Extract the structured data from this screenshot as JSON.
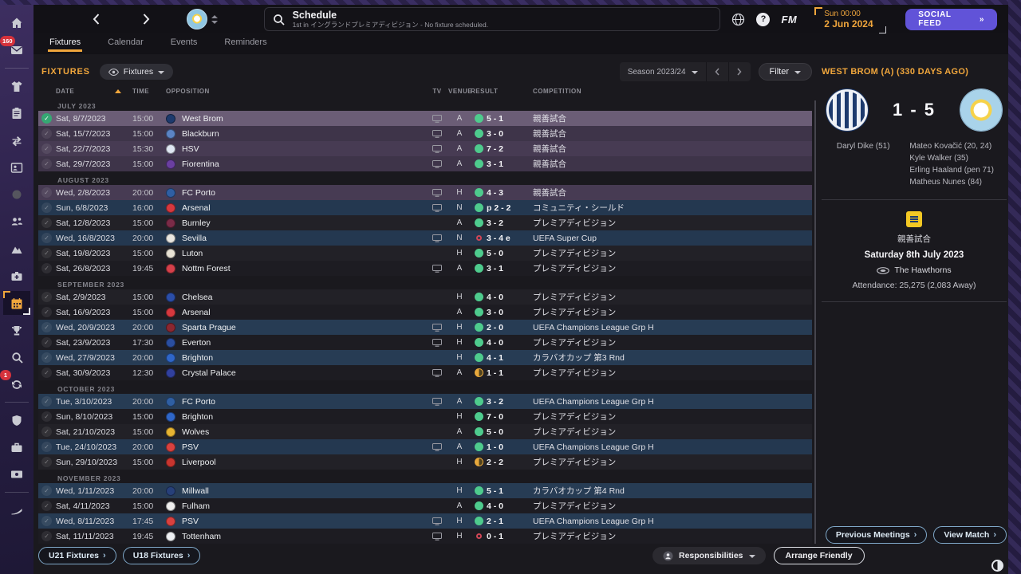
{
  "icons": {
    "help": "?",
    "check": "✓",
    "chevron_right": "›",
    "arrow_double": "»"
  },
  "titlebar": {
    "title": "Schedule",
    "subtitle": "1st in イングランドプレミアディビジョン - No fixture scheduled.",
    "fm_label": "FM",
    "clock_time": "Sun 00:00",
    "clock_date": "2 Jun 2024",
    "social_feed": "SOCIAL FEED"
  },
  "sidebar": {
    "inbox_badge": "160",
    "transfer_badge": "1"
  },
  "tabs": [
    {
      "label": "Fixtures",
      "active": true
    },
    {
      "label": "Calendar",
      "active": false
    },
    {
      "label": "Events",
      "active": false
    },
    {
      "label": "Reminders",
      "active": false
    }
  ],
  "toolbar": {
    "section_label": "FIXTURES",
    "view_label": "Fixtures",
    "season_label": "Season 2023/24",
    "filter_label": "Filter"
  },
  "table_headers": {
    "date": "DATE",
    "time": "TIME",
    "opposition": "OPPOSITION",
    "tv": "TV",
    "venue": "VENUE",
    "result": "RESULT",
    "competition": "COMPETITION"
  },
  "fixtures": {
    "sections": [
      {
        "label": "JULY 2023",
        "rows": [
          {
            "date": "Sat, 8/7/2023",
            "time": "15:00",
            "team": "West Brom",
            "badge": "#1d3a6d",
            "tv": true,
            "venue": "A",
            "outcome": "W",
            "result": "5 - 1",
            "comp": "親善試合",
            "kind": "friendly",
            "selected": true
          },
          {
            "date": "Sat, 15/7/2023",
            "time": "15:00",
            "team": "Blackburn",
            "badge": "#5b84c4",
            "tv": true,
            "venue": "A",
            "outcome": "W",
            "result": "3 - 0",
            "comp": "親善試合",
            "kind": "friendly"
          },
          {
            "date": "Sat, 22/7/2023",
            "time": "15:30",
            "team": "HSV",
            "badge": "#dfe7f2",
            "tv": true,
            "venue": "A",
            "outcome": "W",
            "result": "7 - 2",
            "comp": "親善試合",
            "kind": "friendly"
          },
          {
            "date": "Sat, 29/7/2023",
            "time": "15:00",
            "team": "Fiorentina",
            "badge": "#6a3fa0",
            "tv": true,
            "venue": "A",
            "outcome": "W",
            "result": "3 - 1",
            "comp": "親善試合",
            "kind": "friendly"
          }
        ]
      },
      {
        "label": "AUGUST 2023",
        "rows": [
          {
            "date": "Wed, 2/8/2023",
            "time": "20:00",
            "team": "FC Porto",
            "badge": "#2f5fa3",
            "tv": true,
            "venue": "H",
            "outcome": "W",
            "result": "4 - 3",
            "comp": "親善試合",
            "kind": "friendly"
          },
          {
            "date": "Sun, 6/8/2023",
            "time": "16:00",
            "team": "Arsenal",
            "badge": "#d6383e",
            "tv": true,
            "venue": "N",
            "outcome": "W",
            "result": "p 2 - 2",
            "comp": "コミュニティ・シールド",
            "kind": "cup"
          },
          {
            "date": "Sat, 12/8/2023",
            "time": "15:00",
            "team": "Burnley",
            "badge": "#7a2b47",
            "tv": false,
            "venue": "A",
            "outcome": "W",
            "result": "3 - 2",
            "comp": "プレミアディビジョン",
            "kind": "league"
          },
          {
            "date": "Wed, 16/8/2023",
            "time": "20:00",
            "team": "Sevilla",
            "badge": "#e9e6e0",
            "tv": true,
            "venue": "N",
            "outcome": "L",
            "result": "3 - 4 e",
            "comp": "UEFA Super Cup",
            "kind": "cup"
          },
          {
            "date": "Sat, 19/8/2023",
            "time": "15:00",
            "team": "Luton",
            "badge": "#e8e2d4",
            "tv": false,
            "venue": "H",
            "outcome": "W",
            "result": "5 - 0",
            "comp": "プレミアディビジョン",
            "kind": "league"
          },
          {
            "date": "Sat, 26/8/2023",
            "time": "19:45",
            "team": "Nottm Forest",
            "badge": "#d5404a",
            "tv": true,
            "venue": "A",
            "outcome": "W",
            "result": "3 - 1",
            "comp": "プレミアディビジョン",
            "kind": "league"
          }
        ]
      },
      {
        "label": "SEPTEMBER 2023",
        "rows": [
          {
            "date": "Sat, 2/9/2023",
            "time": "15:00",
            "team": "Chelsea",
            "badge": "#2b4ea8",
            "tv": false,
            "venue": "H",
            "outcome": "W",
            "result": "4 - 0",
            "comp": "プレミアディビジョン",
            "kind": "league"
          },
          {
            "date": "Sat, 16/9/2023",
            "time": "15:00",
            "team": "Arsenal",
            "badge": "#d6383e",
            "tv": false,
            "venue": "A",
            "outcome": "W",
            "result": "3 - 0",
            "comp": "プレミアディビジョン",
            "kind": "league"
          },
          {
            "date": "Wed, 20/9/2023",
            "time": "20:00",
            "team": "Sparta Prague",
            "badge": "#8c2730",
            "tv": true,
            "venue": "H",
            "outcome": "W",
            "result": "2 - 0",
            "comp": "UEFA Champions League Grp H",
            "kind": "cup"
          },
          {
            "date": "Sat, 23/9/2023",
            "time": "17:30",
            "team": "Everton",
            "badge": "#2a4ea0",
            "tv": true,
            "venue": "H",
            "outcome": "W",
            "result": "4 - 0",
            "comp": "プレミアディビジョン",
            "kind": "league"
          },
          {
            "date": "Wed, 27/9/2023",
            "time": "20:00",
            "team": "Brighton",
            "badge": "#2f66c8",
            "tv": false,
            "venue": "H",
            "outcome": "W",
            "result": "4 - 1",
            "comp": "カラバオカップ 第3 Rnd",
            "kind": "cup"
          },
          {
            "date": "Sat, 30/9/2023",
            "time": "12:30",
            "team": "Crystal Palace",
            "badge": "#31409e",
            "tv": true,
            "venue": "A",
            "outcome": "D",
            "result": "1 - 1",
            "comp": "プレミアディビジョン",
            "kind": "league"
          }
        ]
      },
      {
        "label": "OCTOBER 2023",
        "rows": [
          {
            "date": "Tue, 3/10/2023",
            "time": "20:00",
            "team": "FC Porto",
            "badge": "#2f5fa3",
            "tv": true,
            "venue": "A",
            "outcome": "W",
            "result": "3 - 2",
            "comp": "UEFA Champions League Grp H",
            "kind": "cup"
          },
          {
            "date": "Sun, 8/10/2023",
            "time": "15:00",
            "team": "Brighton",
            "badge": "#2f66c8",
            "tv": false,
            "venue": "H",
            "outcome": "W",
            "result": "7 - 0",
            "comp": "プレミアディビジョン",
            "kind": "league"
          },
          {
            "date": "Sat, 21/10/2023",
            "time": "15:00",
            "team": "Wolves",
            "badge": "#e7b432",
            "tv": false,
            "venue": "A",
            "outcome": "W",
            "result": "5 - 0",
            "comp": "プレミアディビジョン",
            "kind": "league"
          },
          {
            "date": "Tue, 24/10/2023",
            "time": "20:00",
            "team": "PSV",
            "badge": "#d9413f",
            "tv": true,
            "venue": "A",
            "outcome": "W",
            "result": "1 - 0",
            "comp": "UEFA Champions League Grp H",
            "kind": "cup"
          },
          {
            "date": "Sun, 29/10/2023",
            "time": "15:00",
            "team": "Liverpool",
            "badge": "#c8352f",
            "tv": false,
            "venue": "H",
            "outcome": "D",
            "result": "2 - 2",
            "comp": "プレミアディビジョン",
            "kind": "league"
          }
        ]
      },
      {
        "label": "NOVEMBER 2023",
        "rows": [
          {
            "date": "Wed, 1/11/2023",
            "time": "20:00",
            "team": "Millwall",
            "badge": "#27407a",
            "tv": false,
            "venue": "H",
            "outcome": "W",
            "result": "5 - 1",
            "comp": "カラバオカップ 第4 Rnd",
            "kind": "cup"
          },
          {
            "date": "Sat, 4/11/2023",
            "time": "15:00",
            "team": "Fulham",
            "badge": "#efefef",
            "tv": false,
            "venue": "A",
            "outcome": "W",
            "result": "4 - 0",
            "comp": "プレミアディビジョン",
            "kind": "league"
          },
          {
            "date": "Wed, 8/11/2023",
            "time": "17:45",
            "team": "PSV",
            "badge": "#d9413f",
            "tv": true,
            "venue": "H",
            "outcome": "W",
            "result": "2 - 1",
            "comp": "UEFA Champions League Grp H",
            "kind": "cup"
          },
          {
            "date": "Sat, 11/11/2023",
            "time": "19:45",
            "team": "Tottenham",
            "badge": "#eef0f4",
            "tv": true,
            "venue": "H",
            "outcome": "L",
            "result": "0 - 1",
            "comp": "プレミアディビジョン",
            "kind": "league"
          }
        ]
      }
    ]
  },
  "detail": {
    "header": "WEST BROM (A) (330 DAYS AGO)",
    "score": "1 - 5",
    "home_scorers": [
      "Daryl Dike (51)"
    ],
    "away_scorers": [
      "Mateo Kovačić (20, 24)",
      "Kyle Walker (35)",
      "Erling Haaland (pen 71)",
      "Matheus Nunes (84)"
    ],
    "competition": "親善試合",
    "match_date": "Saturday 8th July 2023",
    "stadium": "The Hawthorns",
    "attendance": "Attendance: 25,275 (2,083 Away)",
    "prev_meetings": "Previous Meetings",
    "view_match": "View Match"
  },
  "footer": {
    "u21": "U21 Fixtures",
    "u18": "U18 Fixtures",
    "responsibilities": "Responsibilities",
    "arrange_friendly": "Arrange Friendly"
  },
  "colors": {
    "accent_orange": "#f0a63c",
    "win_green": "#4ecb8d",
    "draw_orange": "#e8a83c",
    "loss_red": "#cf4656",
    "social_purple": "#6153d8"
  }
}
